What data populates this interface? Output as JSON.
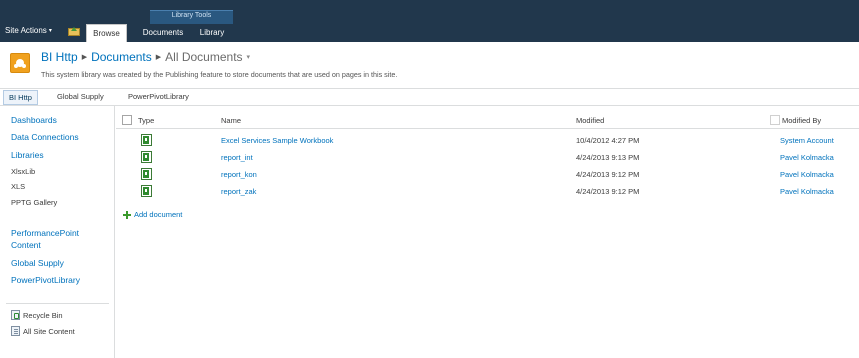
{
  "ribbon": {
    "site_actions": "Site Actions",
    "contextual_group": "Library Tools",
    "tabs": [
      {
        "label": "Browse",
        "selected": true
      },
      {
        "label": "Documents",
        "selected": false
      },
      {
        "label": "Library",
        "selected": false
      }
    ]
  },
  "title": {
    "site": "BI Http",
    "library": "Documents",
    "view": "All Documents",
    "description": "This system library was created by the Publishing feature to store documents that are used on pages in this site."
  },
  "topnav": {
    "items": [
      "BI Http",
      "Global Supply",
      "PowerPivotLibrary"
    ]
  },
  "leftnav": {
    "dashboards": "Dashboards",
    "data_connections": "Data Connections",
    "libraries": "Libraries",
    "library_items": [
      "XlsxLib",
      "XLS",
      "PPTG Gallery"
    ],
    "performancepoint": [
      "PerformancePoint",
      "Content"
    ],
    "global_supply": "Global Supply",
    "powerpivot": "PowerPivotLibrary",
    "recycle_bin": "Recycle Bin",
    "all_site_content": "All Site Content"
  },
  "list": {
    "columns": {
      "type": "Type",
      "name": "Name",
      "modified": "Modified",
      "modified_by": "Modified By"
    },
    "rows": [
      {
        "icon": "excel-icon",
        "name": "Excel Services Sample Workbook",
        "modified": "10/4/2012 4:27 PM",
        "modified_by": "System Account"
      },
      {
        "icon": "excel-icon",
        "name": "report_int",
        "modified": "4/24/2013 9:13 PM",
        "modified_by": "Pavel Kolmacka"
      },
      {
        "icon": "excel-icon",
        "name": "report_kon",
        "modified": "4/24/2013 9:12 PM",
        "modified_by": "Pavel Kolmacka"
      },
      {
        "icon": "excel-icon",
        "name": "report_zak",
        "modified": "4/24/2013 9:12 PM",
        "modified_by": "Pavel Kolmacka"
      }
    ],
    "add_document": "Add document"
  },
  "colors": {
    "ribbon_bg": "#21374c",
    "link": "#0072bc",
    "logo": "#f0a11f"
  }
}
